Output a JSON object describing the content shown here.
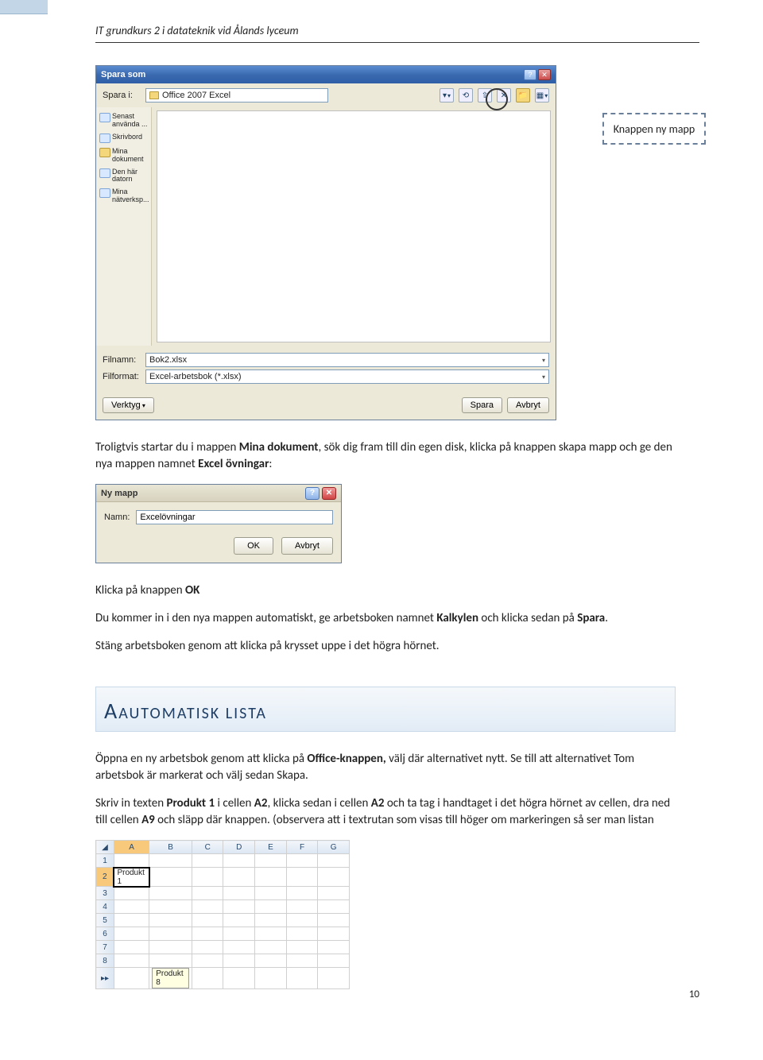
{
  "header": "IT grundkurs 2 i datateknik vid Ålands lyceum",
  "saveDialog": {
    "title": "Spara som",
    "saveInLabel": "Spara i:",
    "folder": "Office 2007 Excel",
    "places": [
      "Senast använda ...",
      "Skrivbord",
      "Mina dokument",
      "Den här datorn",
      "Mina nätverksp..."
    ],
    "filenameLabel": "Filnamn:",
    "filename": "Bok2.xlsx",
    "formatLabel": "Filformat:",
    "format": "Excel-arbetsbok (*.xlsx)",
    "toolsBtn": "Verktyg",
    "saveBtn": "Spara",
    "cancelBtn": "Avbryt"
  },
  "callout": "Knappen ny mapp",
  "para1a": "Troligtvis startar du i mappen ",
  "para1b": "Mina dokument",
  "para1c": ", sök dig fram till din egen disk, klicka på knappen skapa mapp och ge den nya mappen namnet ",
  "para1d": "Excel övningar",
  "para1e": ":",
  "nyMapp": {
    "title": "Ny mapp",
    "nameLabel": "Namn:",
    "value": "Excelövningar",
    "ok": "OK",
    "cancel": "Avbryt"
  },
  "para2a": "Klicka på knappen ",
  "para2b": "OK",
  "para3a": "Du kommer in i den nya mappen automatiskt, ge arbetsboken namnet ",
  "para3b": "Kalkylen",
  "para3c": " och klicka sedan på ",
  "para3d": "Spara",
  "para3e": ".",
  "para4": "Stäng arbetsboken genom att klicka på krysset uppe i det högra hörnet.",
  "sectionTitle": "Automatisk lista",
  "para5a": "Öppna en ny arbetsbok genom att klicka på ",
  "para5b": "Office-knappen,",
  "para5c": " välj där alternativet nytt. Se till att alternativet Tom arbetsbok är markerat och välj sedan Skapa.",
  "para6a": "Skriv in texten ",
  "para6b": "Produkt 1",
  "para6c": " i cellen ",
  "para6d": "A2",
  "para6e": ", klicka sedan i cellen ",
  "para6f": "A2",
  "para6g": " och ta tag i handtaget i det högra hörnet av cellen, dra ned till cellen ",
  "para6h": "A9",
  "para6i": " och släpp där knappen. (observera att i textrutan som visas till höger om markeringen så ser man listan",
  "xl": {
    "cols": [
      "A",
      "B",
      "C",
      "D",
      "E",
      "F",
      "G"
    ],
    "rows": [
      "1",
      "2",
      "3",
      "4",
      "5",
      "6",
      "7",
      "8"
    ],
    "a2": "Produkt 1",
    "tip": "Produkt 8"
  },
  "pageNum": "10"
}
